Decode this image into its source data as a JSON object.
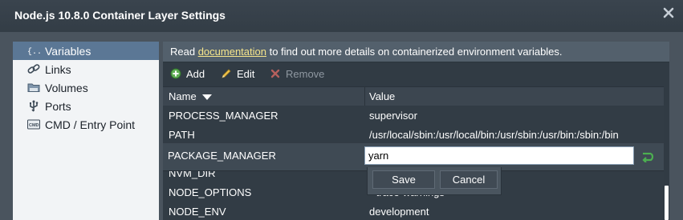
{
  "window": {
    "title": "Node.js 10.8.0 Container Layer Settings"
  },
  "sidebar": {
    "items": [
      {
        "label": "Variables",
        "icon": "variables-icon",
        "active": true
      },
      {
        "label": "Links",
        "icon": "links-icon",
        "active": false
      },
      {
        "label": "Volumes",
        "icon": "volumes-icon",
        "active": false
      },
      {
        "label": "Ports",
        "icon": "ports-icon",
        "active": false
      },
      {
        "label": "CMD / Entry Point",
        "icon": "cmd-icon",
        "active": false
      }
    ]
  },
  "info": {
    "prefix": "Read ",
    "link": "documentation",
    "suffix": " to find out more details on containerized environment variables."
  },
  "toolbar": {
    "add_label": "Add",
    "edit_label": "Edit",
    "remove_label": "Remove"
  },
  "table": {
    "columns": [
      {
        "label": "Name"
      },
      {
        "label": "Value"
      }
    ],
    "rows": [
      {
        "name": "PROCESS_MANAGER",
        "value": "supervisor"
      },
      {
        "name": "PATH",
        "value": "/usr/local/sbin:/usr/local/bin:/usr/sbin:/usr/bin:/sbin:/bin"
      },
      {
        "name": "NVM_DIR",
        "value": ""
      },
      {
        "name": "NODE_OPTIONS",
        "value": "--trace-warnings"
      },
      {
        "name": "NODE_ENV",
        "value": "development"
      }
    ],
    "editing": {
      "name": "PACKAGE_MANAGER",
      "value": "yarn"
    },
    "editor": {
      "save_label": "Save",
      "cancel_label": "Cancel"
    }
  },
  "colors": {
    "accent": "#5b7795",
    "link": "#f6e58b",
    "panel": "#313b44",
    "confirm": "#4caf50"
  }
}
